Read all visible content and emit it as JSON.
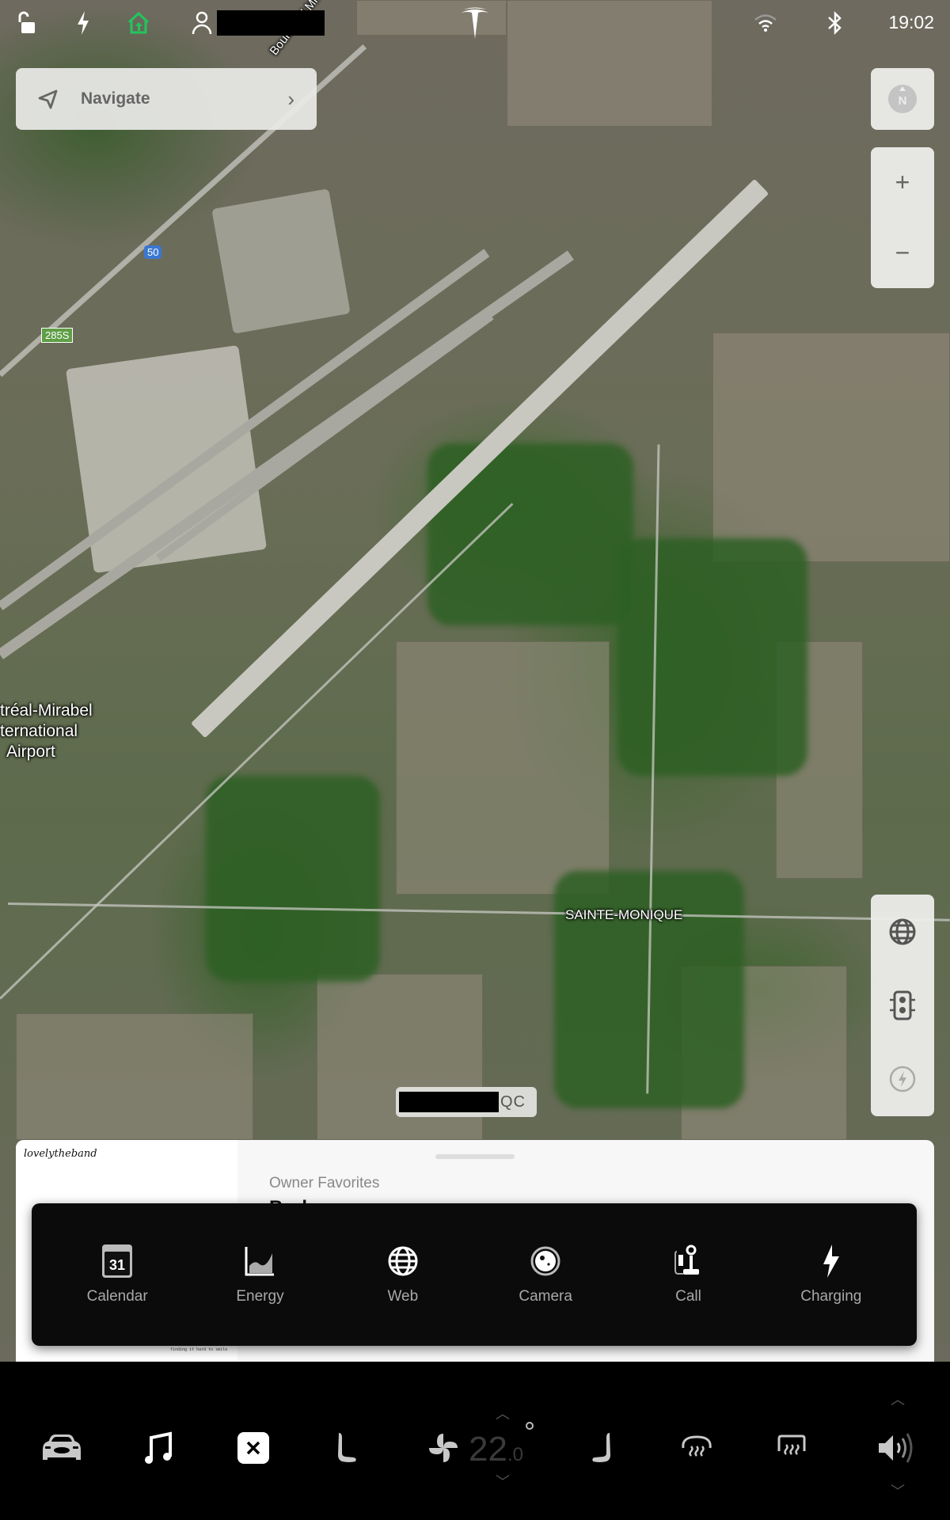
{
  "status_bar": {
    "icons": [
      "unlock-icon",
      "lightning-icon",
      "home-icon",
      "profile-icon",
      "tesla-logo-icon",
      "wifi-icon",
      "bluetooth-icon"
    ],
    "home_icon_color": "#22c55e",
    "profile_name": "[redacted]",
    "time": "19:02"
  },
  "navigate": {
    "label": "Navigate"
  },
  "map": {
    "labels": {
      "airport_line1": "tréal-Mirabel",
      "airport_line2": "ternational",
      "airport_line3": "Airport",
      "road": "Boulevard Mirabel",
      "town": "SAINTE-MONIQUE"
    },
    "shields": {
      "route_50": "50",
      "route_285s": "285S"
    },
    "compass_label": "N",
    "zoom_in_label": "+",
    "zoom_out_label": "−",
    "layers": [
      "globe-icon",
      "traffic-light-icon",
      "charging-station-icon"
    ],
    "location_suffix": "QC"
  },
  "media": {
    "band": "lovelytheband",
    "album_caption": "finding it hard to smile",
    "source": "Owner Favorites",
    "track": "Broken"
  },
  "apps": [
    {
      "id": "calendar",
      "label": "Calendar",
      "icon": "calendar-icon",
      "badge": "31"
    },
    {
      "id": "energy",
      "label": "Energy",
      "icon": "energy-chart-icon"
    },
    {
      "id": "web",
      "label": "Web",
      "icon": "globe-icon"
    },
    {
      "id": "camera",
      "label": "Camera",
      "icon": "camera-icon"
    },
    {
      "id": "call",
      "label": "Call",
      "icon": "call-icon"
    },
    {
      "id": "charging",
      "label": "Charging",
      "icon": "lightning-icon"
    }
  ],
  "dock": {
    "items": [
      "car-icon",
      "music-icon",
      "close-app-icon",
      "driver-seat-icon",
      "fan-icon",
      "passenger-seat-icon",
      "front-defrost-icon",
      "rear-defrost-icon",
      "volume-icon"
    ],
    "temperature_whole": "22",
    "temperature_decimal": ".0",
    "temperature_unit": "°"
  }
}
